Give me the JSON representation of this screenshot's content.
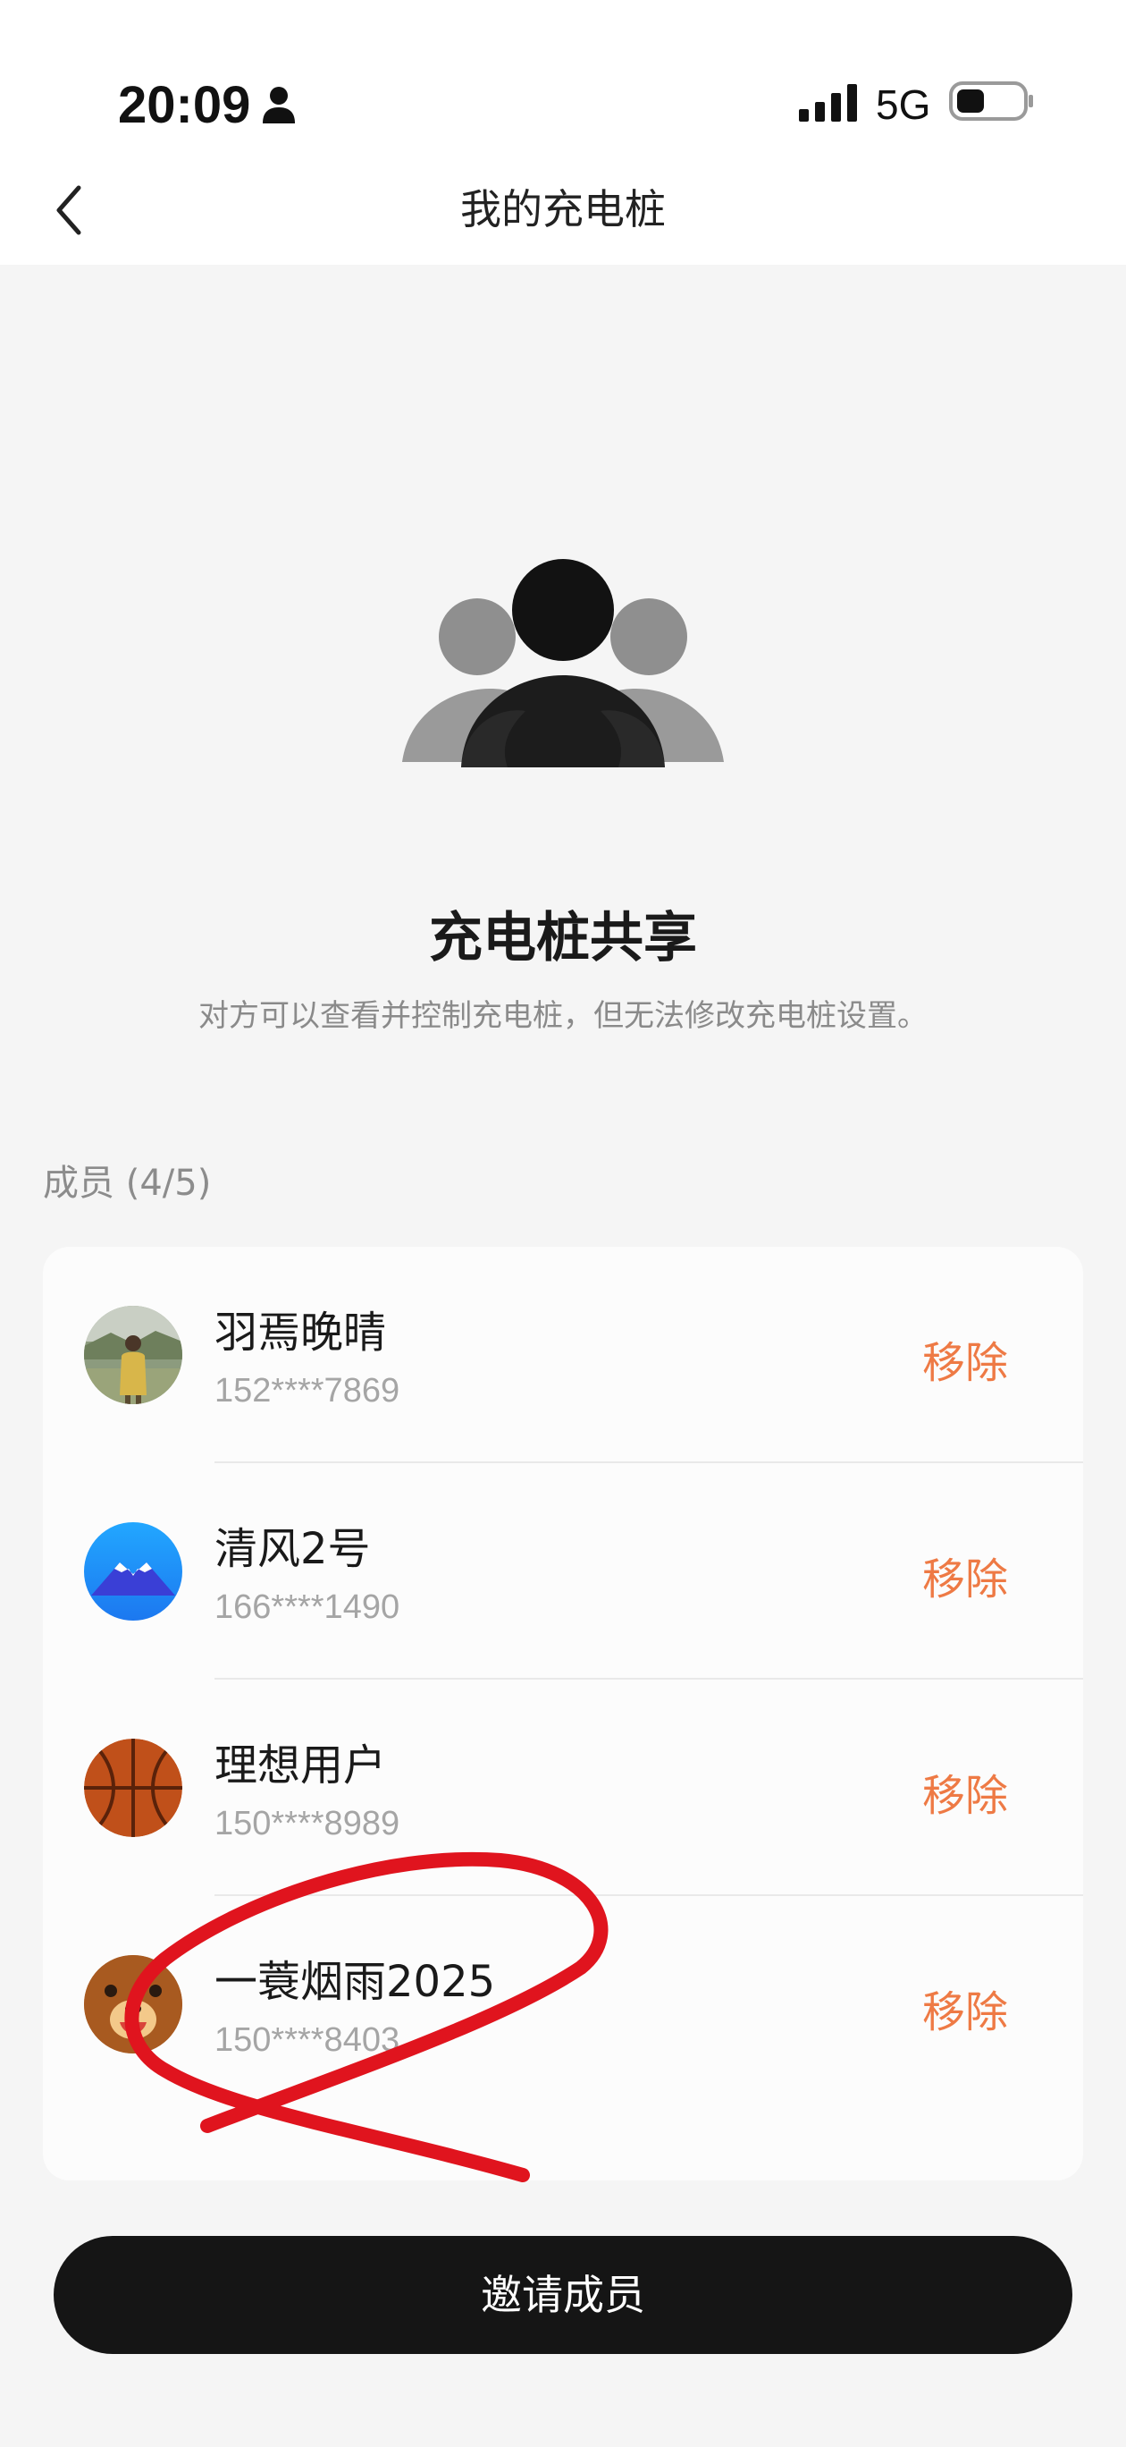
{
  "status_bar": {
    "time": "20:09",
    "network": "5G",
    "icons": [
      "person-icon",
      "signal-icon",
      "battery-icon"
    ]
  },
  "nav": {
    "title": "我的充电桩",
    "back_icon": "chevron-left-icon"
  },
  "share": {
    "title": "充电桩共享",
    "description": "对方可以查看并控制充电桩，但无法修改充电桩设置。"
  },
  "members": {
    "label": "成员 (4/5)",
    "items": [
      {
        "name": "羽焉晚晴",
        "phone": "152****7869",
        "remove_label": "移除",
        "avatar": "photo-avatar"
      },
      {
        "name": "清风2号",
        "phone": "166****1490",
        "remove_label": "移除",
        "avatar": "mountain-avatar"
      },
      {
        "name": "理想用户",
        "phone": "150****8989",
        "remove_label": "移除",
        "avatar": "basketball-avatar"
      },
      {
        "name": "一蓑烟雨2025",
        "phone": "150****8403",
        "remove_label": "移除",
        "avatar": "bear-avatar"
      }
    ]
  },
  "invite_button": {
    "label": "邀请成员"
  },
  "colors": {
    "accent": "#ee7a45",
    "primary_button": "#151515",
    "background": "#f5f5f5",
    "annotation": "#e0141e"
  }
}
